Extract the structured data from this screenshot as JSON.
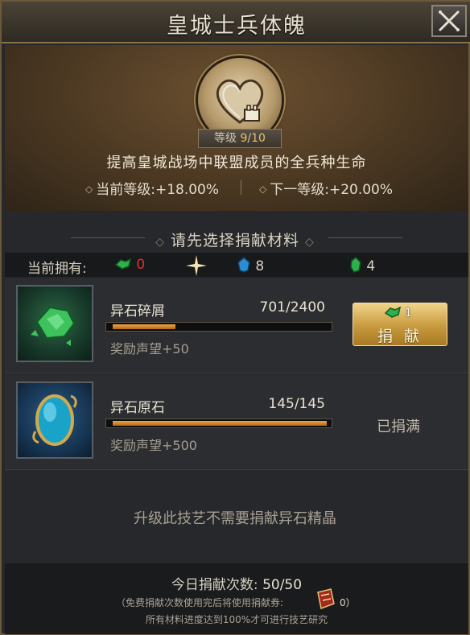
{
  "window": {
    "title": "皇城士兵体魄",
    "close_icon": "close-icon"
  },
  "skill": {
    "level_label": "等级",
    "level_current": "9",
    "level_sep": "/",
    "level_max": "10",
    "description": "提高皇城战场中联盟成员的全兵种生命",
    "current_label": "当前等级:+18.00%",
    "next_label": "下一等级:+20.00%"
  },
  "section": {
    "title": "请先选择捐献材料"
  },
  "owned": {
    "label": "当前拥有:",
    "items": [
      {
        "icon": "green-shard-icon",
        "value": "0",
        "color": "#e0312a"
      },
      {
        "icon": "sparkle-icon",
        "value": ""
      },
      {
        "icon": "blue-gem-icon",
        "value": "8"
      },
      {
        "icon": "green-gem-icon",
        "value": "4"
      }
    ]
  },
  "materials": [
    {
      "name": "异石碎屑",
      "count": "701/2400",
      "progress": 0.292,
      "reward": "奖励声望+50",
      "donate_cost": "1",
      "donate_label": "捐 献"
    },
    {
      "name": "异石原石",
      "count": "145/145",
      "progress": 1.0,
      "reward": "奖励声望+500",
      "full_label": "已捐满"
    }
  ],
  "notice": "升级此技艺不需要捐献异石精晶",
  "footer": {
    "daily_label": "今日捐献次数:",
    "daily_value": "50/50",
    "note1": "（免费捐献次数使用完后将使用捐献券:",
    "ticket_count": "0",
    "note1_end": "）",
    "note2": "所有材料进度达到100%才可进行技艺研究"
  },
  "colors": {
    "accent_gold": "#c89a3e",
    "progress_orange": "#e08a2a",
    "warning_red": "#e0312a"
  }
}
